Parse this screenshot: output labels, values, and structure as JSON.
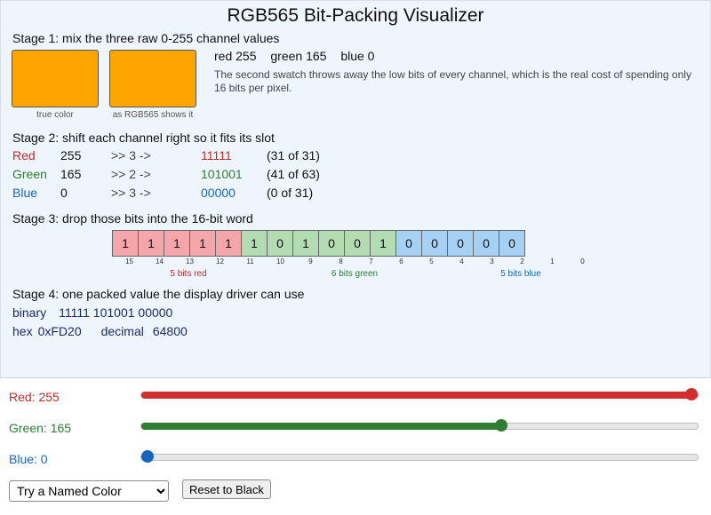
{
  "title": "RGB565 Bit-Packing Visualizer",
  "stage1": {
    "heading": "Stage 1: mix the three raw 0-255 channel values",
    "true_color": "#ffa500",
    "rgb565_color": "#ffa500",
    "true_label": "true color",
    "rgb565_label": "as RGB565 shows it",
    "red_text": "red 255",
    "green_text": "green 165",
    "blue_text": "blue 0",
    "note": "The second swatch throws away the low bits of every channel, which is the real cost of spending only 16 bits per pixel."
  },
  "stage2": {
    "heading": "Stage 2: shift each channel right so it fits its slot",
    "rows": [
      {
        "name": "Red",
        "value": "255",
        "shift": ">> 3  ->",
        "bits": "11111",
        "range": "(31 of 31)"
      },
      {
        "name": "Green",
        "value": "165",
        "shift": ">> 2  ->",
        "bits": "101001",
        "range": "(41 of 63)"
      },
      {
        "name": "Blue",
        "value": "0",
        "shift": ">> 3  ->",
        "bits": "00000",
        "range": "(0 of 31)"
      }
    ]
  },
  "stage3": {
    "heading": "Stage 3: drop those bits into the 16-bit word",
    "bits": [
      "1",
      "1",
      "1",
      "1",
      "1",
      "1",
      "0",
      "1",
      "0",
      "0",
      "1",
      "0",
      "0",
      "0",
      "0",
      "0"
    ],
    "indices": [
      "15",
      "14",
      "13",
      "12",
      "11",
      "10",
      "9",
      "8",
      "7",
      "6",
      "5",
      "4",
      "3",
      "2",
      "1",
      "0"
    ],
    "red_label": "5 bits red",
    "green_label": "6 bits green",
    "blue_label": "5 bits blue"
  },
  "stage4": {
    "heading": "Stage 4: one packed value the display driver can use",
    "binary_label": "binary",
    "binary_value": "11111 101001 00000",
    "hex_label": "hex",
    "hex_value": "0xFD20",
    "decimal_label": "decimal",
    "decimal_value": "64800"
  },
  "controls": {
    "red_label": "Red: 255",
    "green_label": "Green: 165",
    "blue_label": "Blue: 0",
    "red_value": 255,
    "green_value": 165,
    "blue_value": 0,
    "slider_max": 255,
    "red_color": "#d32f2f",
    "green_color": "#2e7d32",
    "blue_color": "#1565c0",
    "named_color_select": "Try a Named Color",
    "reset_button": "Reset to Black"
  }
}
